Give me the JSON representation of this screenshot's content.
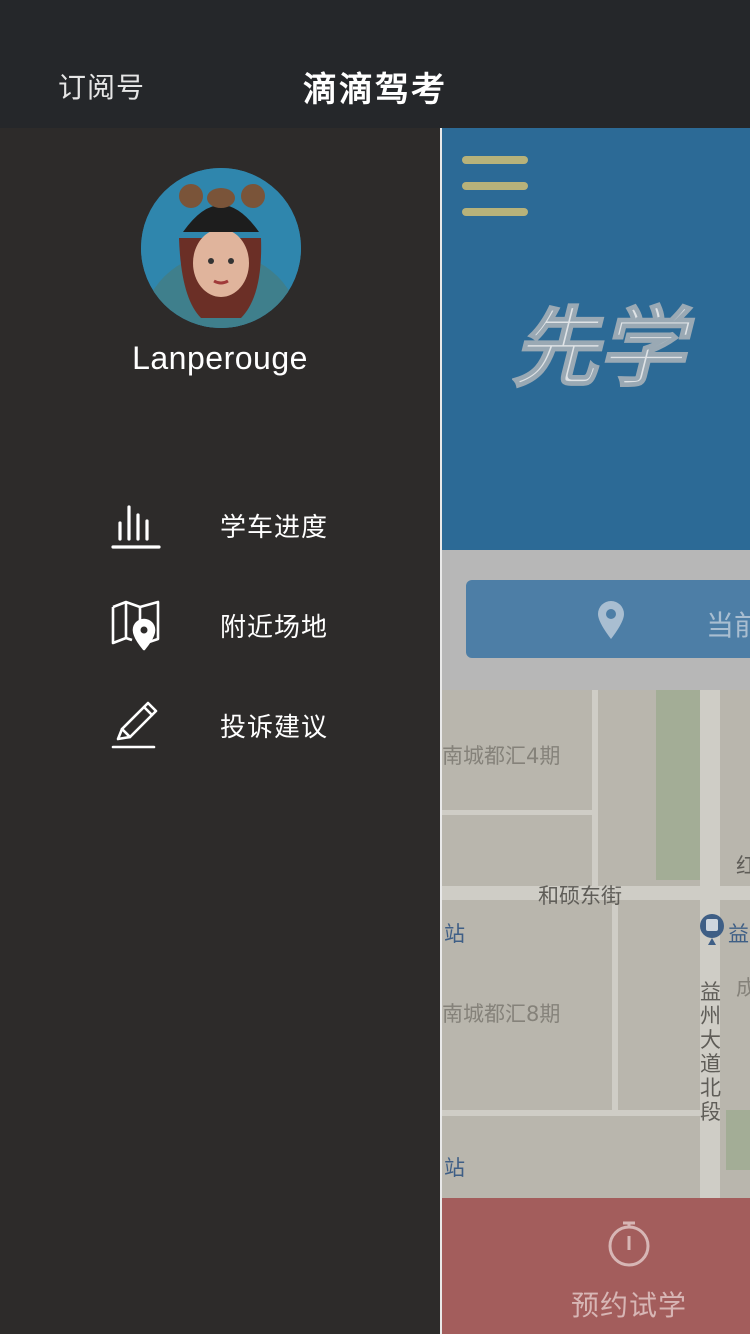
{
  "header": {
    "left_link": "订阅号",
    "title": "滴滴驾考"
  },
  "drawer": {
    "username": "Lanperouge",
    "menu": [
      {
        "icon": "bar-chart-icon",
        "label": "学车进度"
      },
      {
        "icon": "map-pin-icon",
        "label": "附近场地"
      },
      {
        "icon": "pencil-icon",
        "label": "投诉建议"
      }
    ]
  },
  "main": {
    "banner_text": "先学",
    "location_label": "当前定",
    "map_labels": [
      "南城都汇4期",
      "和硕东街",
      "站",
      "益",
      "南城都汇8期",
      "益州大道北段",
      "站",
      "红",
      "成"
    ],
    "book_button": "预约试学"
  },
  "colors": {
    "topbar": "#25272a",
    "drawer": "#2d2b2a",
    "banner": "#2c6a96",
    "book_button": "#a35d5c"
  }
}
